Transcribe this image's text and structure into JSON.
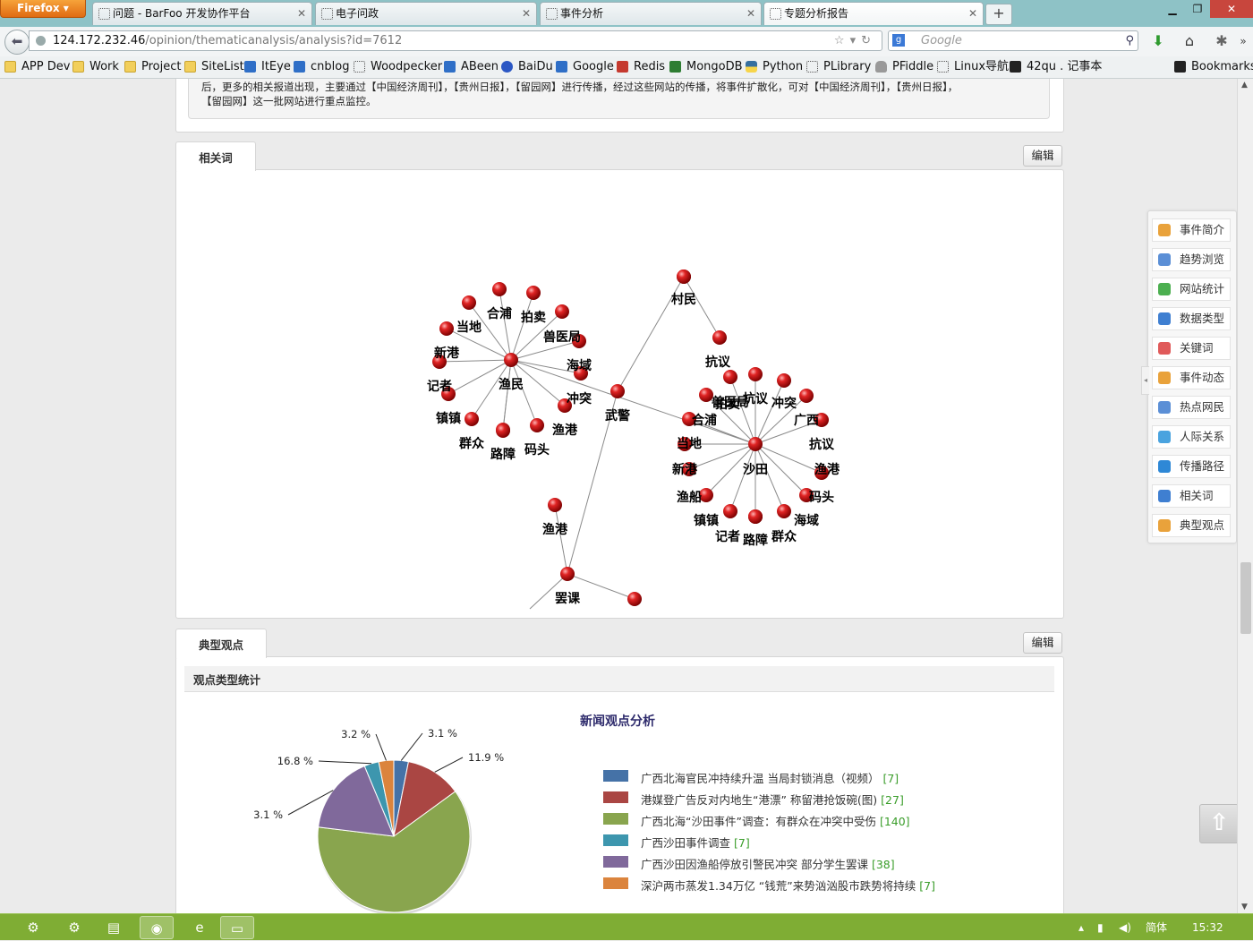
{
  "browser": {
    "menu_label": "Firefox",
    "tabs": [
      {
        "title": "问题 - BarFoo 开发协作平台",
        "active": false
      },
      {
        "title": "电子问政",
        "active": false
      },
      {
        "title": "事件分析",
        "active": false
      },
      {
        "title": "专题分析报告",
        "active": true
      }
    ],
    "new_tab": "+",
    "url_host": "124.172.232.46",
    "url_path": "/opinion/thematicanalysis/analysis?id=7612",
    "search_placeholder": "Google",
    "bookmarks": [
      {
        "label": "APP Dev",
        "icon": "folder-icon"
      },
      {
        "label": "Work",
        "icon": "folder-icon"
      },
      {
        "label": "Project",
        "icon": "folder-icon"
      },
      {
        "label": "SiteList",
        "icon": "folder-icon"
      },
      {
        "label": "ItEye",
        "icon": "iteye-icon"
      },
      {
        "label": "cnblog",
        "icon": "cnblog-icon"
      },
      {
        "label": "Woodpecker",
        "icon": "page-icon"
      },
      {
        "label": "ABeen",
        "icon": "abeen-icon"
      },
      {
        "label": "BaiDu",
        "icon": "paw-icon"
      },
      {
        "label": "Google",
        "icon": "google-icon"
      },
      {
        "label": "Redis",
        "icon": "redis-icon"
      },
      {
        "label": "MongoDB",
        "icon": "mongodb-icon"
      },
      {
        "label": "Python",
        "icon": "python-icon"
      },
      {
        "label": "PLibrary",
        "icon": "page-icon"
      },
      {
        "label": "PFiddle",
        "icon": "cloud-icon"
      },
      {
        "label": "Linux导航",
        "icon": "page-icon"
      },
      {
        "label": "42qu . 记事本",
        "icon": "42qu-icon"
      }
    ],
    "bookmarks_menu": "Bookmarks"
  },
  "summary": {
    "line1": "后，更多的相关报道出现，主要通过【中国经济周刊】，【贵州日报】，【留园网】进行传播，经过这些网站的传播，将事件扩散化，可对【中国经济周刊】，【贵州日报】，",
    "line2": "【留园网】这一批网站进行重点监控。"
  },
  "related_words": {
    "tab_label": "相关词",
    "edit_label": "编辑",
    "hubs": [
      "渔民",
      "武警",
      "村民",
      "沙田",
      "罢课"
    ],
    "graph_labels": [
      "合浦",
      "拍卖",
      "当地",
      "兽医局",
      "新港",
      "海域",
      "记者",
      "冲突",
      "镇镇",
      "渔港",
      "群众",
      "码头",
      "路障",
      "抗议",
      "兽医局",
      "冲突",
      "拍卖",
      "广西",
      "合浦",
      "抗议",
      "当地",
      "渔港",
      "新港",
      "码头",
      "渔船",
      "海域",
      "镇镇",
      "群众",
      "记者",
      "路障",
      "渔港"
    ]
  },
  "typical_views": {
    "tab_label": "典型观点",
    "edit_label": "编辑",
    "subheading": "观点类型统计"
  },
  "side_nav": [
    {
      "label": "事件简介",
      "icon": "book-icon",
      "color": "#e9a23b"
    },
    {
      "label": "趋势浏览",
      "icon": "trend-icon",
      "color": "#5b8fd6"
    },
    {
      "label": "网站统计",
      "icon": "bar-chart-icon",
      "color": "#4caf50"
    },
    {
      "label": "数据类型",
      "icon": "database-icon",
      "color": "#3f7fd1"
    },
    {
      "label": "关键词",
      "icon": "tag-icon",
      "color": "#e05a5a"
    },
    {
      "label": "事件动态",
      "icon": "dynamic-icon",
      "color": "#e9a23b"
    },
    {
      "label": "热点网民",
      "icon": "user-icon",
      "color": "#5b8fd6"
    },
    {
      "label": "人际关系",
      "icon": "network-icon",
      "color": "#4aa3df"
    },
    {
      "label": "传播路径",
      "icon": "globe-icon",
      "color": "#2e88d6"
    },
    {
      "label": "相关词",
      "icon": "signal-icon",
      "color": "#3f7fd1"
    },
    {
      "label": "典型观点",
      "icon": "thumb-icon",
      "color": "#e9a23b"
    }
  ],
  "chart_data": {
    "type": "pie",
    "title": "新闻观点分析",
    "series": [
      {
        "name": "广西北海官民冲持续升温 当局封锁消息（视频）",
        "value": 7,
        "percent": 3.1,
        "color": "#4572a7"
      },
      {
        "name": "港媒登广告反对内地生“港漂” 称留港抢饭碗(图)",
        "value": 27,
        "percent": 11.9,
        "color": "#aa4643"
      },
      {
        "name": "广西北海“沙田事件”调查：有群众在冲突中受伤",
        "value": 140,
        "percent": 62.0,
        "color": "#89a54e"
      },
      {
        "name": "广西沙田事件调查",
        "value": 7,
        "percent": 3.1,
        "color": "#3d96ae"
      },
      {
        "name": "广西沙田因渔船停放引警民冲突 部分学生罢课",
        "value": 38,
        "percent": 16.8,
        "color": "#80699b"
      },
      {
        "name": "深沪两市蒸发1.34万亿 “钱荒”来势汹汹股市跌势将持续",
        "value": 7,
        "percent": 3.2,
        "color": "#db843d"
      }
    ],
    "slice_labels": [
      "3.1 %",
      "11.9 %",
      "3.1 %",
      "16.8 %",
      "3.2 %"
    ]
  },
  "taskbar": {
    "ime": "简体",
    "time": "15:32"
  }
}
